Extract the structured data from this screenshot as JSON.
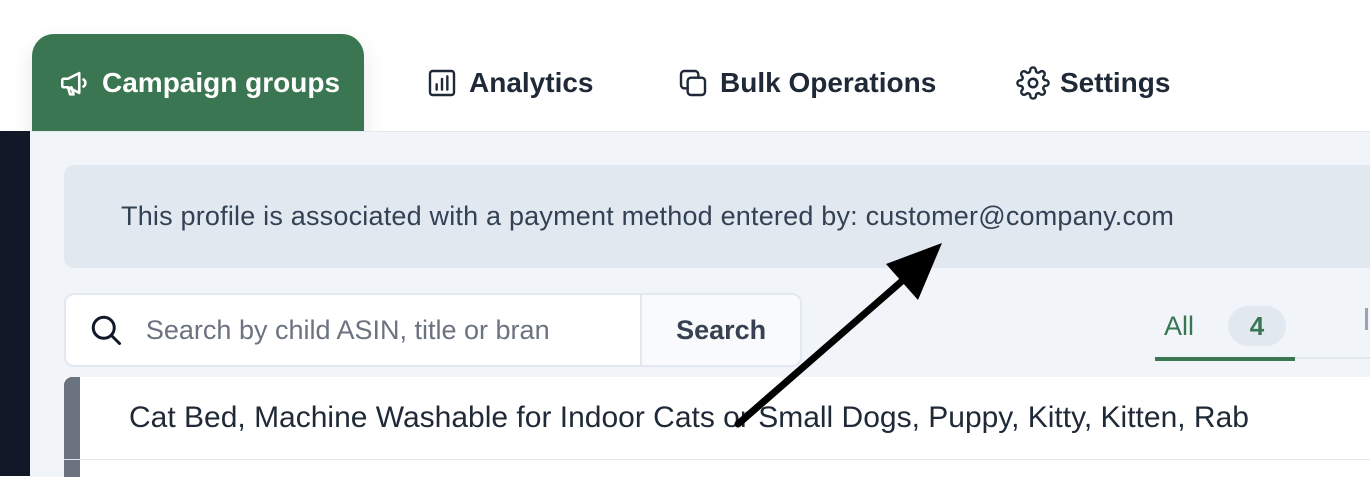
{
  "tabs": [
    {
      "label": "Campaign groups",
      "icon": "megaphone-icon",
      "active": true
    },
    {
      "label": "Analytics",
      "icon": "bar-chart-icon",
      "active": false
    },
    {
      "label": "Bulk Operations",
      "icon": "copy-icon",
      "active": false
    },
    {
      "label": "Settings",
      "icon": "gear-icon",
      "active": false
    }
  ],
  "notice": {
    "text": "This profile is associated with a payment method entered by: customer@company.com"
  },
  "search": {
    "placeholder": "Search by child ASIN, title or bran",
    "value": "",
    "button_label": "Search",
    "icon": "search-icon"
  },
  "filters": {
    "all_label": "All",
    "all_count": "4"
  },
  "list": {
    "rows": [
      {
        "title": "Cat Bed, Machine Washable for Indoor Cats or Small Dogs, Puppy, Kitty, Kitten, Rab"
      }
    ]
  },
  "colors": {
    "accent": "#3a7651",
    "panel": "#f1f5f9",
    "notice_bg": "#e2e8f0",
    "sidebar": "#111827"
  }
}
